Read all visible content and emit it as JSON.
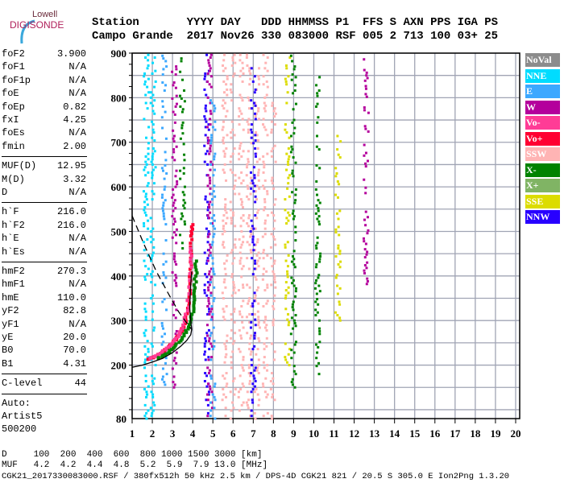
{
  "logo": {
    "line1": "Lowell",
    "line2": "DIGISONDE"
  },
  "header": {
    "labels": "Station       YYYY DAY   DDD HHMMSS P1  FFS S AXN PPS IGA PS",
    "values": "Campo Grande  2017 Nov26 330 083000 RSF 005 2 713 100 03+ 25"
  },
  "params": [
    {
      "group": [
        {
          "k": "foF2",
          "v": "3.900"
        },
        {
          "k": "foF1",
          "v": "N/A"
        },
        {
          "k": "foF1p",
          "v": "N/A"
        },
        {
          "k": "foE",
          "v": "N/A"
        },
        {
          "k": "foEp",
          "v": "0.82"
        },
        {
          "k": "fxI",
          "v": "4.25"
        },
        {
          "k": "foEs",
          "v": "N/A"
        },
        {
          "k": "fmin",
          "v": "2.00"
        }
      ]
    },
    {
      "group": [
        {
          "k": "MUF(D)",
          "v": "12.95"
        },
        {
          "k": "M(D)",
          "v": "3.32"
        },
        {
          "k": "D",
          "v": "N/A"
        }
      ]
    },
    {
      "group": [
        {
          "k": "h`F",
          "v": "216.0"
        },
        {
          "k": "h`F2",
          "v": "216.0"
        },
        {
          "k": "h`E",
          "v": "N/A"
        },
        {
          "k": "h`Es",
          "v": "N/A"
        }
      ]
    },
    {
      "group": [
        {
          "k": "hmF2",
          "v": "270.3"
        },
        {
          "k": "hmF1",
          "v": "N/A"
        },
        {
          "k": "hmE",
          "v": "110.0"
        },
        {
          "k": "yF2",
          "v": "82.8"
        },
        {
          "k": "yF1",
          "v": "N/A"
        },
        {
          "k": "yE",
          "v": "20.0"
        },
        {
          "k": "B0",
          "v": "70.0"
        },
        {
          "k": "B1",
          "v": "4.31"
        }
      ]
    },
    {
      "group": [
        {
          "k": "C-level",
          "v": "44"
        }
      ]
    },
    {
      "group": [
        {
          "k": "Auto:",
          "v": ""
        },
        {
          "k": "Artist5",
          "v": ""
        },
        {
          "k": "500200",
          "v": ""
        }
      ]
    }
  ],
  "legend": [
    {
      "label": "NoVal",
      "color": "#8c8c8c"
    },
    {
      "label": "NNE",
      "color": "#00dcff"
    },
    {
      "label": "E",
      "color": "#3ca8ff"
    },
    {
      "label": "W",
      "color": "#b4009c"
    },
    {
      "label": "Vo-",
      "color": "#ff3c96"
    },
    {
      "label": "Vo+",
      "color": "#ff0032"
    },
    {
      "label": "SSW",
      "color": "#ffb4b4"
    },
    {
      "label": "X-",
      "color": "#008200"
    },
    {
      "label": "X+",
      "color": "#80b464"
    },
    {
      "label": "SSE",
      "color": "#dcdc00"
    },
    {
      "label": "NNW",
      "color": "#2800ff"
    }
  ],
  "footer": {
    "d_row": "D     100  200  400  600  800 1000 1500 3000 [km]",
    "muf_row": "MUF   4.2  4.2  4.4  4.8  5.2  5.9  7.9 13.0 [MHz]",
    "file_row": "CGK21_2017330083000.RSF / 380fx512h 50 kHz 2.5 km / DPS-4D CGK21 821 / 20.5 S 305.0 E Ion2Png 1.3.20"
  },
  "chart_data": {
    "type": "scatter",
    "xlim": [
      1,
      20.2
    ],
    "ylim": [
      80,
      900
    ],
    "x_ticks": [
      1,
      2,
      3,
      4,
      5,
      6,
      7,
      8,
      9,
      10,
      11,
      12,
      13,
      14,
      15,
      16,
      17,
      18,
      19,
      20
    ],
    "y_ticks": [
      80,
      200,
      300,
      400,
      500,
      600,
      700,
      800,
      900
    ],
    "grid": true,
    "legend_placement": "right",
    "traces": [
      {
        "color": "Vo+",
        "points": [
          [
            1.8,
            213
          ],
          [
            2.2,
            220
          ],
          [
            2.6,
            232
          ],
          [
            3.0,
            248
          ],
          [
            3.3,
            265
          ],
          [
            3.55,
            285
          ],
          [
            3.7,
            310
          ],
          [
            3.8,
            345
          ],
          [
            3.88,
            390
          ],
          [
            3.92,
            440
          ],
          [
            3.95,
            490
          ],
          [
            3.97,
            520
          ]
        ]
      },
      {
        "color": "Vo-",
        "points": [
          [
            1.9,
            215
          ],
          [
            2.4,
            226
          ],
          [
            2.9,
            244
          ],
          [
            3.2,
            260
          ],
          [
            3.5,
            282
          ],
          [
            3.75,
            330
          ],
          [
            3.9,
            420
          ],
          [
            3.95,
            470
          ]
        ]
      },
      {
        "color": "X-",
        "points": [
          [
            2.3,
            215
          ],
          [
            2.7,
            225
          ],
          [
            3.1,
            240
          ],
          [
            3.5,
            262
          ],
          [
            3.8,
            285
          ],
          [
            4.0,
            320
          ],
          [
            4.1,
            360
          ],
          [
            4.15,
            400
          ],
          [
            4.2,
            440
          ]
        ]
      }
    ],
    "profile": [
      [
        1.0,
        195
      ],
      [
        1.5,
        200
      ],
      [
        2.0,
        207
      ],
      [
        2.5,
        215
      ],
      [
        3.0,
        228
      ],
      [
        3.4,
        242
      ],
      [
        3.7,
        255
      ],
      [
        3.9,
        268
      ],
      [
        3.95,
        280
      ],
      [
        3.9,
        300
      ],
      [
        3.85,
        330
      ],
      [
        3.9,
        380
      ],
      [
        3.95,
        410
      ]
    ],
    "muf_curve": [
      [
        1.0,
        535
      ],
      [
        1.6,
        470
      ],
      [
        2.2,
        410
      ],
      [
        2.8,
        360
      ],
      [
        3.3,
        320
      ],
      [
        3.7,
        295
      ],
      [
        3.95,
        280
      ]
    ],
    "noise_columns": [
      {
        "f": 1.7,
        "h": [
          80,
          900
        ],
        "color": "NNE"
      },
      {
        "f": 2.05,
        "h": [
          80,
          900
        ],
        "color": "NNE"
      },
      {
        "f": 2.6,
        "h": [
          150,
          900
        ],
        "color": "E"
      },
      {
        "f": 3.1,
        "h": [
          150,
          900
        ],
        "color": "W"
      },
      {
        "f": 3.5,
        "h": [
          450,
          900
        ],
        "color": "X-"
      },
      {
        "f": 4.7,
        "h": [
          80,
          900
        ],
        "color": "NNW"
      },
      {
        "f": 4.85,
        "h": [
          80,
          900
        ],
        "color": "W"
      },
      {
        "f": 5.0,
        "h": [
          80,
          800
        ],
        "color": "E"
      },
      {
        "f": 5.6,
        "h": [
          80,
          900
        ],
        "color": "SSW"
      },
      {
        "f": 6.0,
        "h": [
          80,
          900
        ],
        "color": "SSW"
      },
      {
        "f": 6.4,
        "h": [
          80,
          900
        ],
        "color": "SSW"
      },
      {
        "f": 6.8,
        "h": [
          80,
          900
        ],
        "color": "SSW"
      },
      {
        "f": 7.2,
        "h": [
          80,
          900
        ],
        "color": "SSW"
      },
      {
        "f": 7.6,
        "h": [
          80,
          900
        ],
        "color": "SSW"
      },
      {
        "f": 8.0,
        "h": [
          80,
          800
        ],
        "color": "SSW"
      },
      {
        "f": 7.0,
        "h": [
          80,
          900
        ],
        "color": "NNW"
      },
      {
        "f": 8.7,
        "h": [
          200,
          900
        ],
        "color": "SSE"
      },
      {
        "f": 9.0,
        "h": [
          150,
          900
        ],
        "color": "X-"
      },
      {
        "f": 10.2,
        "h": [
          180,
          850
        ],
        "color": "X-"
      },
      {
        "f": 11.2,
        "h": [
          300,
          720
        ],
        "color": "SSE"
      },
      {
        "f": 12.6,
        "h": [
          370,
          900
        ],
        "color": "W"
      }
    ]
  }
}
